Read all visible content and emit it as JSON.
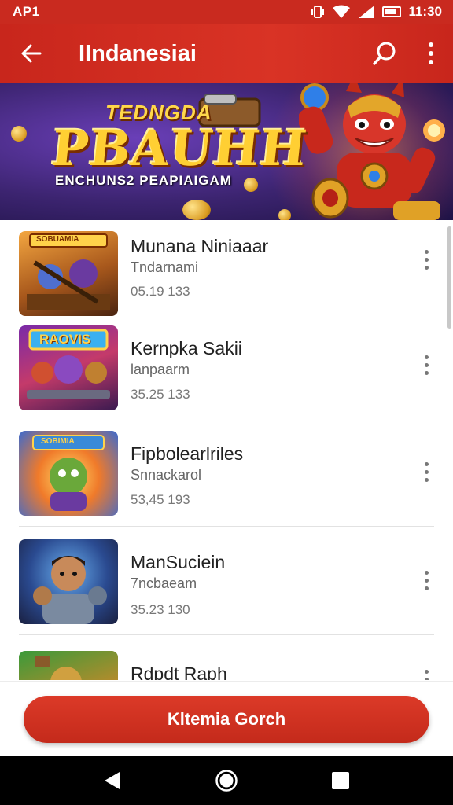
{
  "status_bar": {
    "left_text": "AP1",
    "time": "11:30",
    "icons": [
      "vibrate-icon",
      "wifi-icon",
      "signal-icon",
      "battery-icon"
    ]
  },
  "app_bar": {
    "title": "IIndanesiai",
    "back_icon": "arrow-left-icon",
    "search_icon": "search-icon",
    "more_icon": "more-vertical-icon"
  },
  "banner": {
    "kicker": "TEDNGDA",
    "title": "PBAUHH",
    "subtitle": "ENCHUNS2 PEAPIAIGAM"
  },
  "list": {
    "items": [
      {
        "title": "Munana Niniaaar",
        "subtitle": "Tndarnami",
        "meta": "05.19 133",
        "thumb_label": "SOBUAMIA",
        "menu_icon": "more-vertical-icon"
      },
      {
        "title": "Kernpka Sakii",
        "subtitle": "lanpaarm",
        "meta": "35.25 133",
        "thumb_label": "RAOVIS",
        "menu_icon": "more-vertical-icon"
      },
      {
        "title": "Fipbolearlriles",
        "subtitle": "Snnackarol",
        "meta": "53,45 193",
        "thumb_label": "SOBIMIA",
        "menu_icon": "more-vertical-icon"
      },
      {
        "title": "ManSuciein",
        "subtitle": "7ncbaeam",
        "meta": "35.23 130",
        "thumb_label": "",
        "menu_icon": "more-vertical-icon"
      },
      {
        "title": "Rdpdt Raph",
        "subtitle": "",
        "meta": "",
        "thumb_label": "",
        "menu_icon": "more-vertical-icon"
      }
    ]
  },
  "action": {
    "primary_label": "Kltemia Gorch"
  },
  "nav_bar": {
    "icons": [
      "back-triangle-icon",
      "home-circle-icon",
      "recents-square-icon"
    ]
  },
  "colors": {
    "accent": "#c92a1f",
    "button": "#d4321f",
    "nav": "#000000"
  }
}
